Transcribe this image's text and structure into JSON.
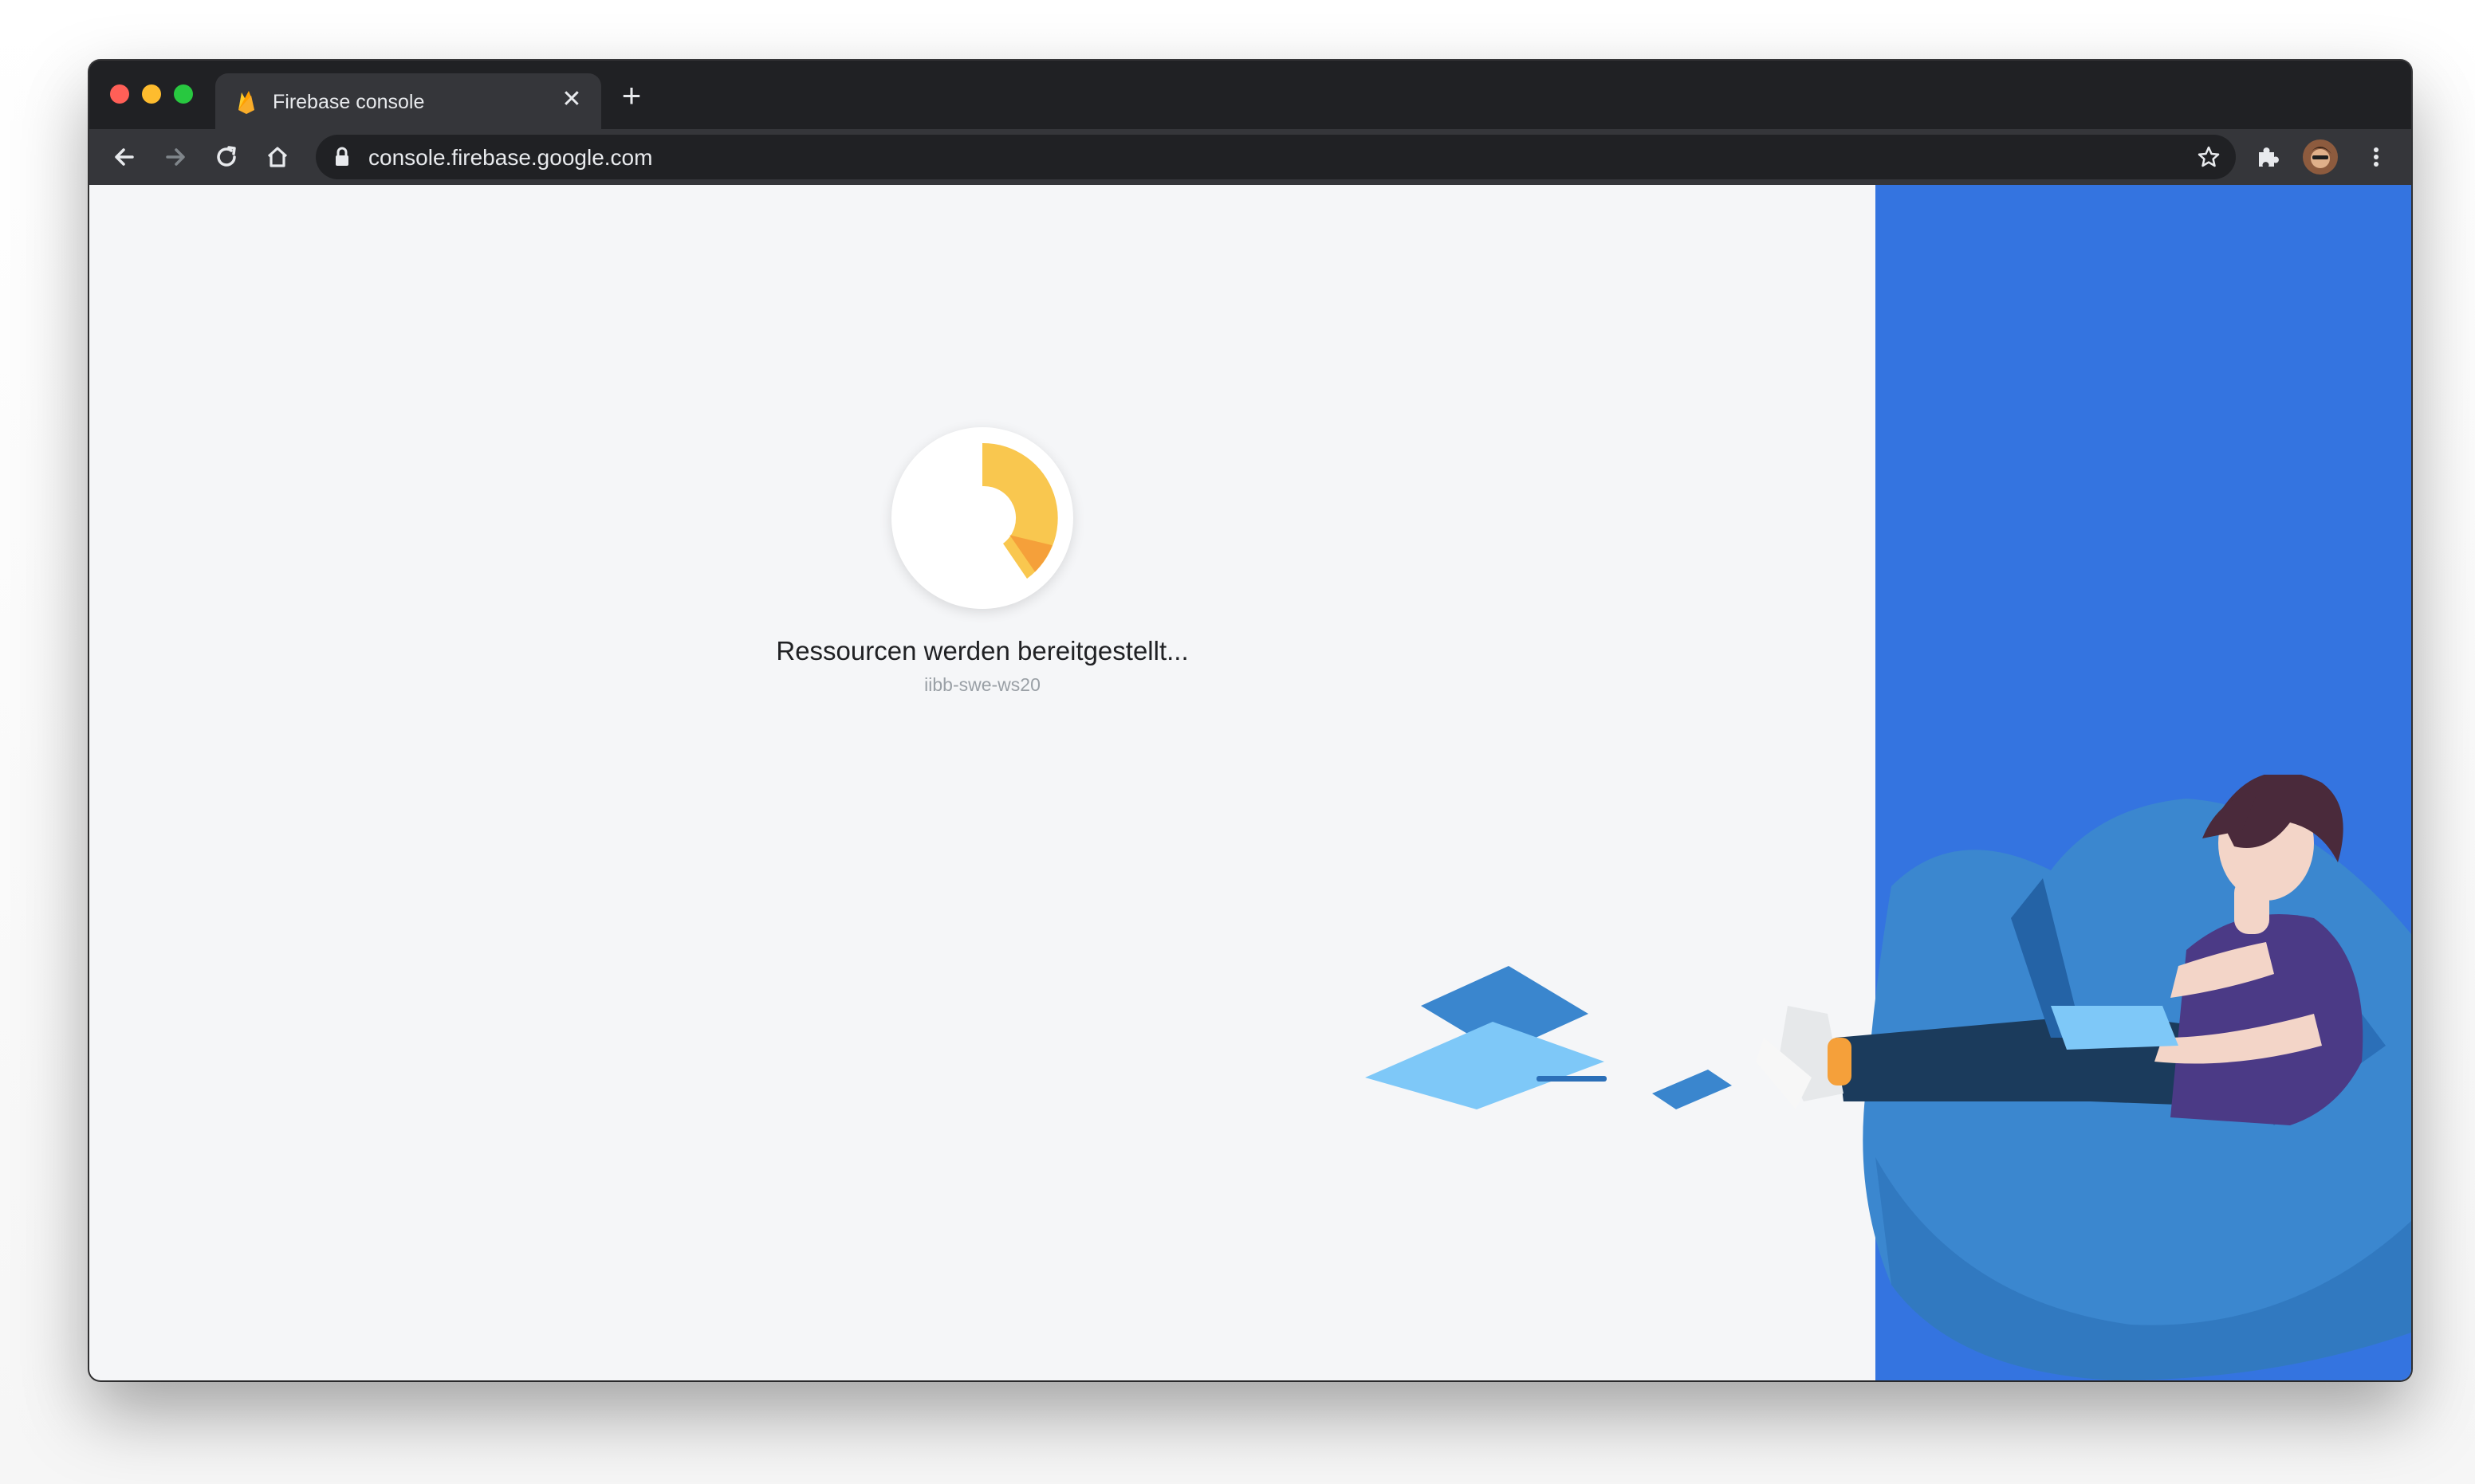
{
  "browser": {
    "tab": {
      "title": "Firebase console",
      "favicon": "firebase-flame-icon",
      "close_icon": "close-icon"
    },
    "new_tab_icon": "plus-icon",
    "toolbar": {
      "back_icon": "arrow-left-icon",
      "forward_icon": "arrow-right-icon",
      "reload_icon": "reload-icon",
      "home_icon": "home-icon",
      "extensions_icon": "puzzle-icon",
      "menu_icon": "more-vertical-icon"
    },
    "address_bar": {
      "url": "console.firebase.google.com",
      "lock_icon": "lock-icon",
      "bookmark_icon": "star-icon"
    }
  },
  "page": {
    "loading_message": "Ressourcen werden bereitgestellt...",
    "project_id": "iibb-swe-ws20"
  },
  "colors": {
    "accent_blue": "#3474e0",
    "spinner_yellow": "#f9c74f",
    "spinner_orange": "#f5a03a",
    "page_background": "#f5f6f8"
  }
}
